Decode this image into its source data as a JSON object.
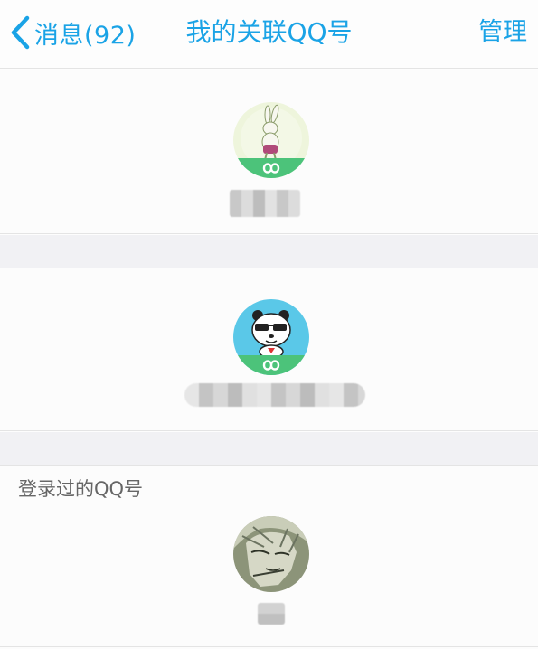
{
  "navbar": {
    "back_label": "消息(92)",
    "title": "我的关联QQ号",
    "manage_label": "管理",
    "accent_color": "#1aa3e6"
  },
  "linked_accounts": [
    {
      "avatar": "rabbit-avatar",
      "linked_badge": "infinity-icon",
      "name_hidden": true
    },
    {
      "avatar": "panda-sunglasses-avatar",
      "linked_badge": "infinity-icon",
      "name_hidden": true
    }
  ],
  "logged_in_section": {
    "label": "登录过的QQ号",
    "accounts": [
      {
        "avatar": "manga-character-avatar",
        "name_hidden": true
      }
    ]
  }
}
